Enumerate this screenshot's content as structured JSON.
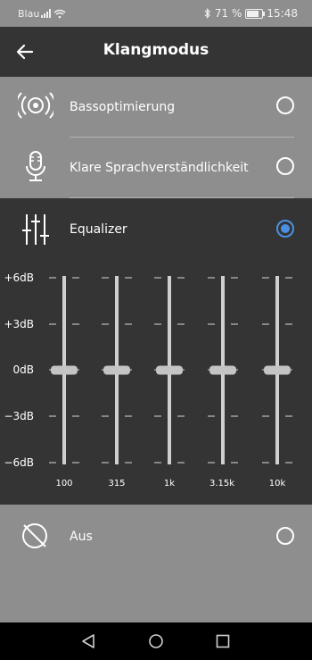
{
  "status": {
    "carrier": "Blau",
    "battery": "71 %",
    "time": "15:48"
  },
  "appbar": {
    "title": "Klangmodus"
  },
  "options": {
    "bass": {
      "label": "Bassoptimierung",
      "selected": false
    },
    "speech": {
      "label": "Klare Sprachverständlichkeit",
      "selected": false
    },
    "equalizer": {
      "label": "Equalizer",
      "selected": true
    },
    "off": {
      "label": "Aus",
      "selected": false
    }
  },
  "equalizer": {
    "db_labels": [
      "+6dB",
      "+3dB",
      "0dB",
      "−3dB",
      "−6dB"
    ],
    "bands": [
      {
        "freq": "100",
        "gain_db": 0
      },
      {
        "freq": "315",
        "gain_db": 0
      },
      {
        "freq": "1k",
        "gain_db": 0
      },
      {
        "freq": "3.15k",
        "gain_db": 0
      },
      {
        "freq": "10k",
        "gain_db": 0
      }
    ]
  },
  "colors": {
    "accent": "#4a90e2",
    "panel": "#343434",
    "background": "#8e8e8e"
  },
  "icons": [
    "back-arrow-icon",
    "speaker-waves-icon",
    "microphone-icon",
    "sliders-icon",
    "circle-slash-icon",
    "nav-back-icon",
    "nav-home-icon",
    "nav-recents-icon"
  ]
}
